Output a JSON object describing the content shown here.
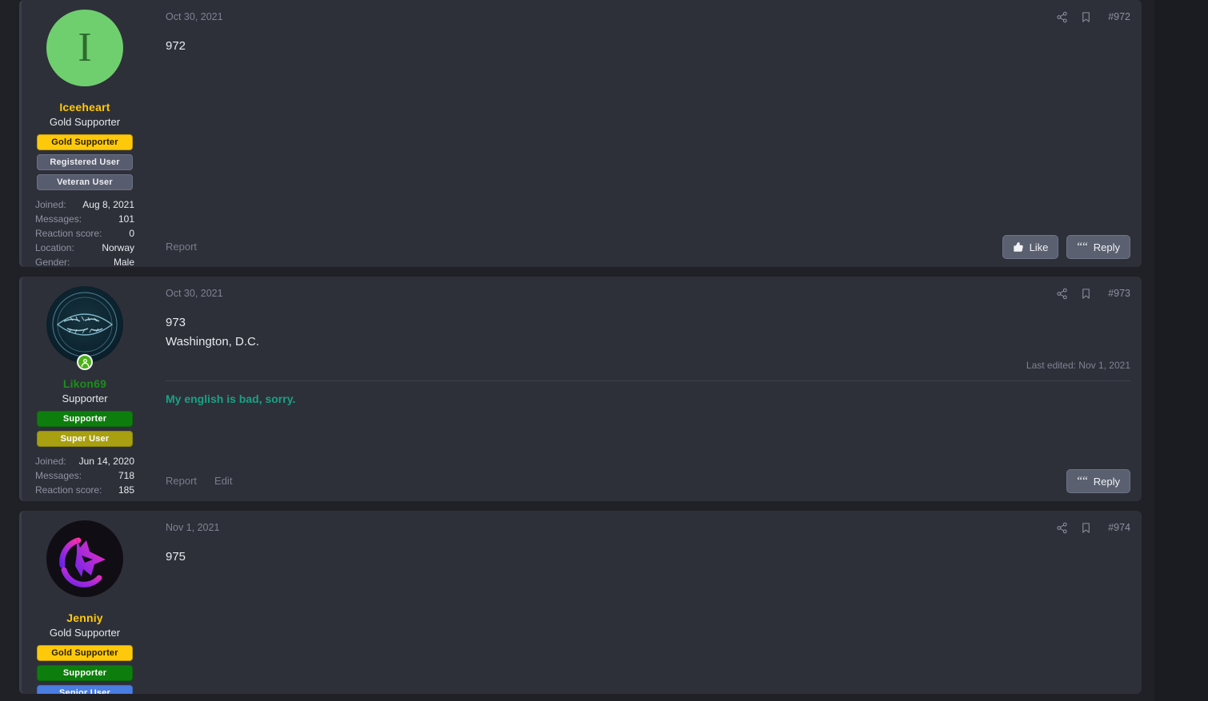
{
  "theme": {
    "page_bg": "#1b1c21",
    "column_bg": "#202127",
    "post_bg": "#2e3039",
    "accent_gold": "#ffc90b",
    "accent_green": "#0d7e0d",
    "signature_color": "#18a383"
  },
  "posts": [
    {
      "id": "post-0",
      "date": "Oct 30, 2021",
      "number": "#972",
      "body": "972",
      "user": {
        "name": "Iceeheart",
        "name_color": "#ffc90b",
        "title": "Gold Supporter",
        "avatar_type": "letter",
        "avatar_letter": "I",
        "online": false,
        "banners": [
          {
            "label": "Gold Supporter",
            "style": "gold"
          },
          {
            "label": "Registered User",
            "style": "grey"
          },
          {
            "label": "Veteran User",
            "style": "grey"
          }
        ],
        "stats": [
          {
            "key": "Joined:",
            "value": "Aug 8, 2021"
          },
          {
            "key": "Messages:",
            "value": "101"
          },
          {
            "key": "Reaction score:",
            "value": "0"
          },
          {
            "key": "Location:",
            "value": "Norway"
          },
          {
            "key": "Gender:",
            "value": "Male"
          }
        ]
      },
      "signature": null,
      "last_edited": null,
      "foot_links": [
        "Report"
      ],
      "actions": [
        {
          "label": "Like",
          "icon": "thumbs-up-icon"
        },
        {
          "label": "Reply",
          "icon": "quote-icon"
        }
      ]
    },
    {
      "id": "post-1",
      "date": "Oct 30, 2021",
      "number": "#973",
      "body": "973\nWashington, D.C.",
      "user": {
        "name": "Likon69",
        "name_color": "#1a8f1a",
        "title": "Supporter",
        "avatar_type": "ring",
        "avatar_letter": "",
        "online": true,
        "banners": [
          {
            "label": "Supporter",
            "style": "green"
          },
          {
            "label": "Super User",
            "style": "olive"
          }
        ],
        "stats": [
          {
            "key": "Joined:",
            "value": "Jun 14, 2020"
          },
          {
            "key": "Messages:",
            "value": "718"
          },
          {
            "key": "Reaction score:",
            "value": "185"
          }
        ]
      },
      "signature": "My english is bad, sorry.",
      "last_edited": "Last edited: Nov 1, 2021",
      "foot_links": [
        "Report",
        "Edit"
      ],
      "actions": [
        {
          "label": "Reply",
          "icon": "quote-icon"
        }
      ]
    },
    {
      "id": "post-2",
      "date": "Nov 1, 2021",
      "number": "#974",
      "body": "975",
      "user": {
        "name": "Jenniy",
        "name_color": "#ffc90b",
        "title": "Gold Supporter",
        "avatar_type": "wolf",
        "avatar_letter": "",
        "online": false,
        "banners": [
          {
            "label": "Gold Supporter",
            "style": "gold"
          },
          {
            "label": "Supporter",
            "style": "green"
          },
          {
            "label": "Senior User",
            "style": "blue"
          }
        ],
        "stats": []
      },
      "signature": null,
      "last_edited": null,
      "foot_links": [],
      "actions": []
    }
  ]
}
